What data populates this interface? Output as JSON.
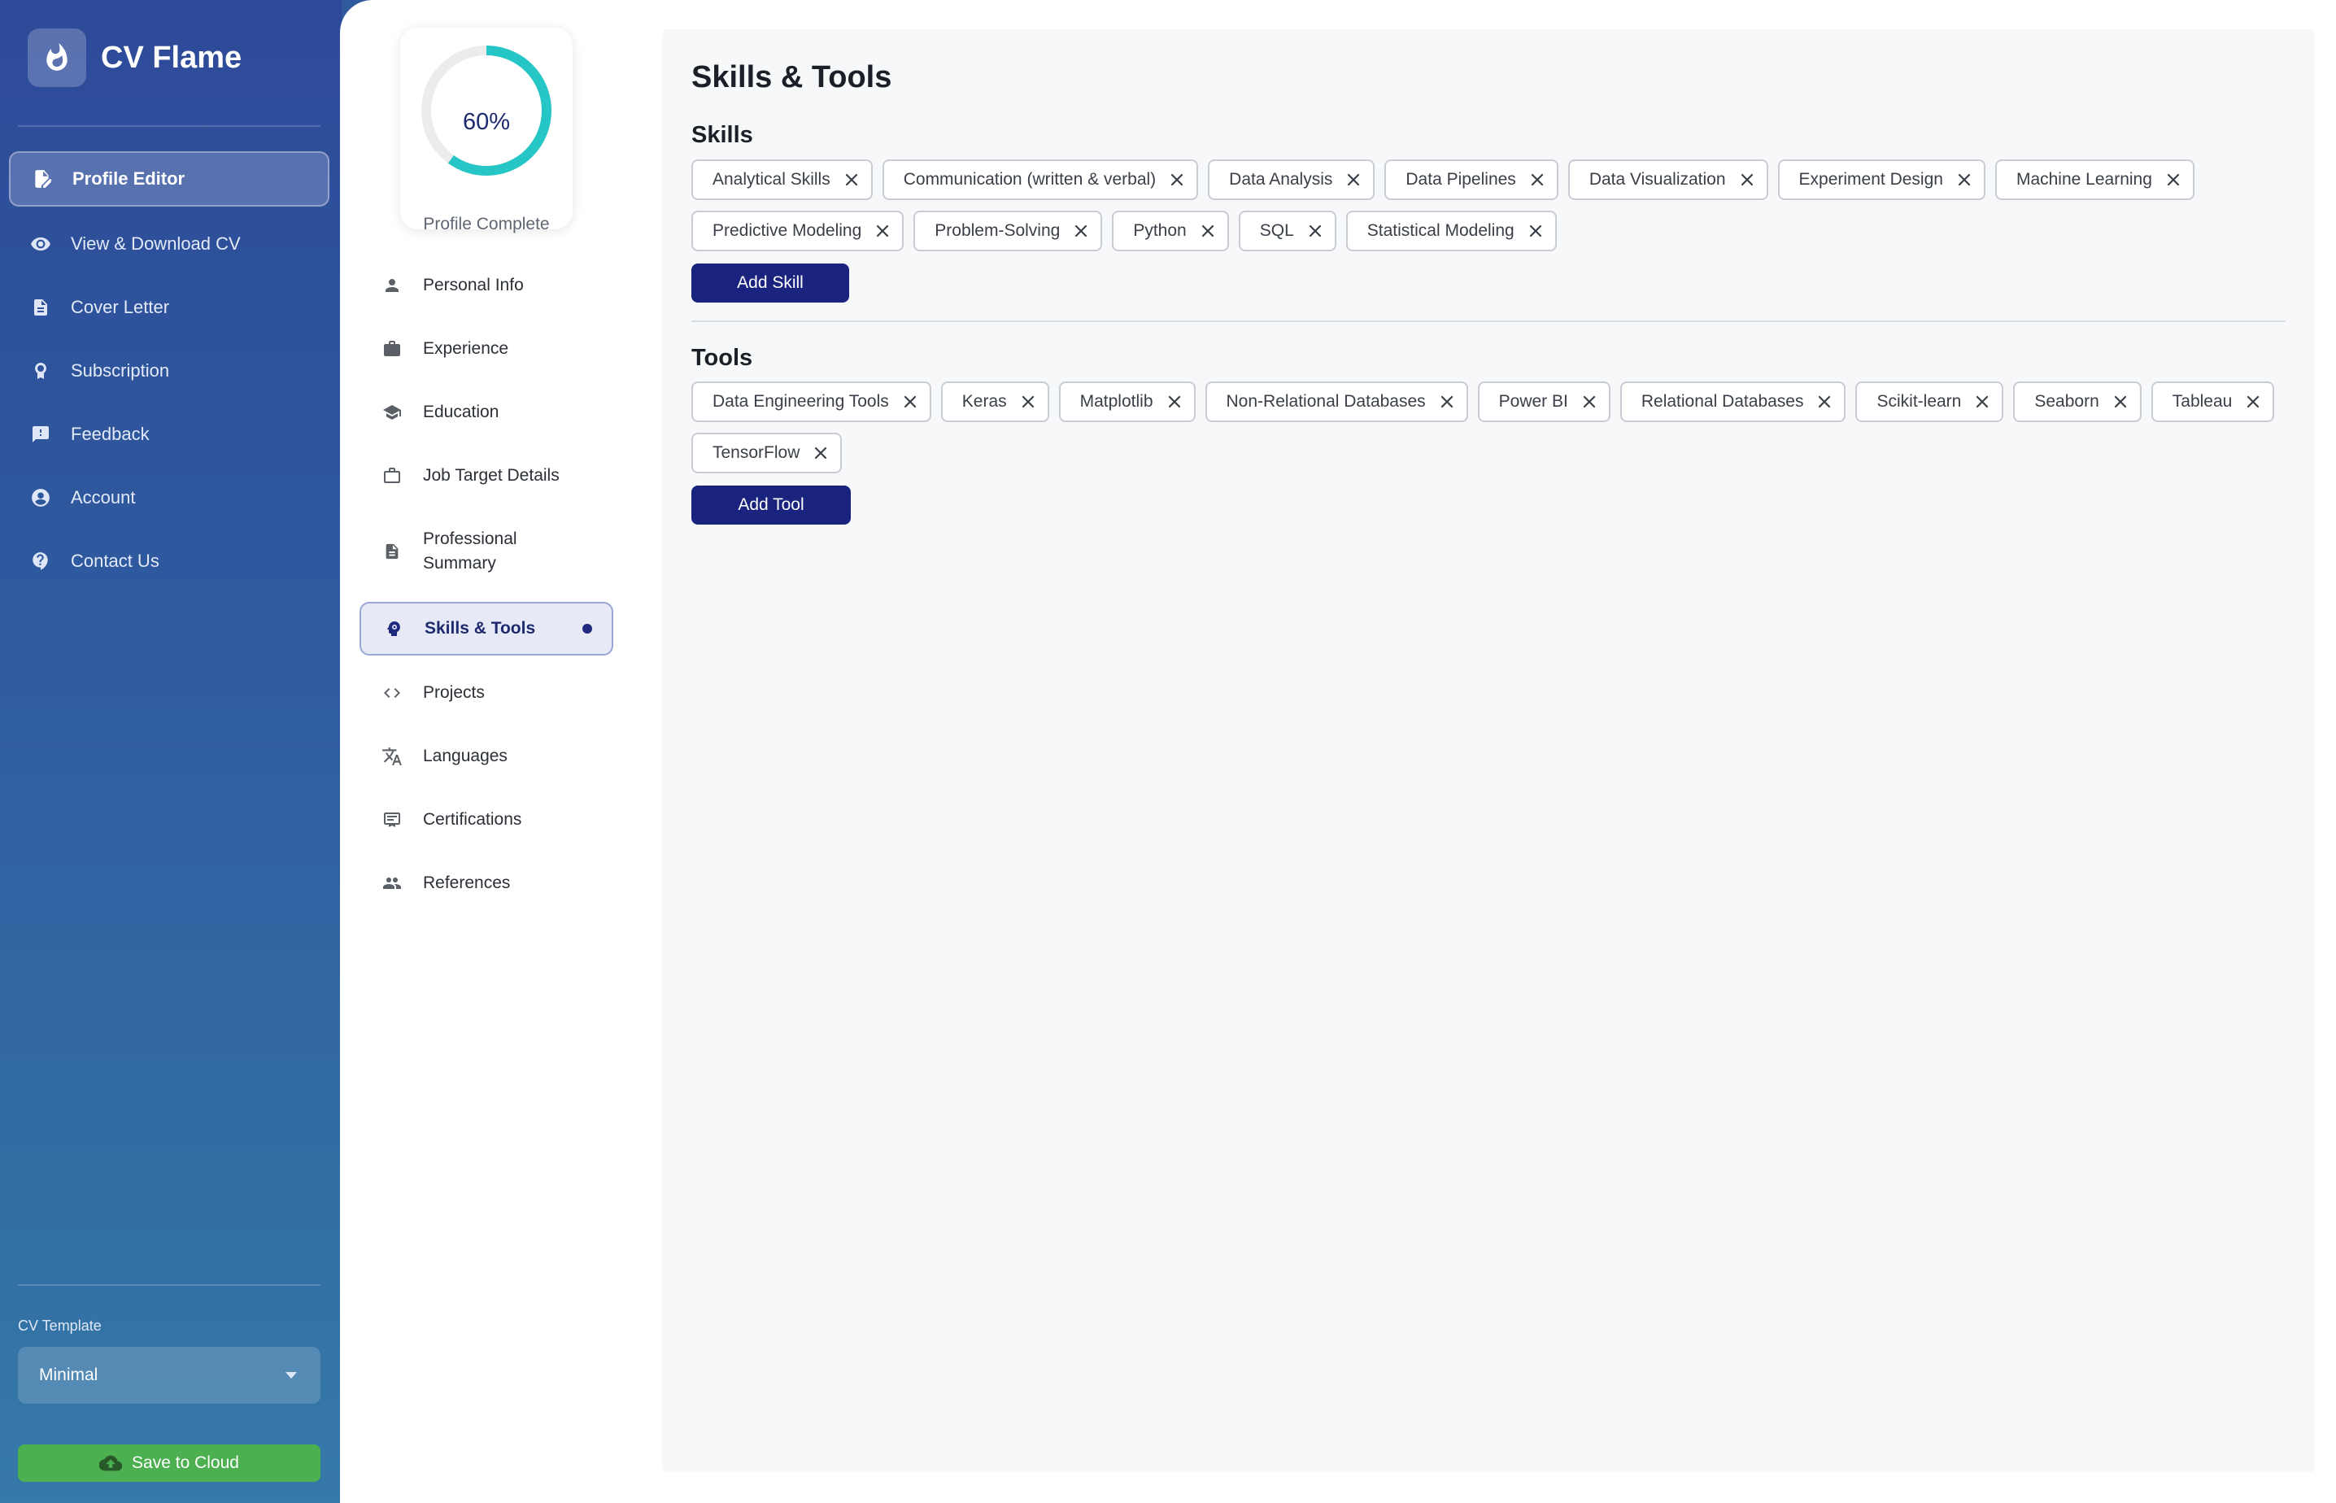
{
  "app": {
    "brand": "CV Flame",
    "nav": [
      {
        "label": "Profile Editor",
        "icon": "edit-document-icon"
      },
      {
        "label": "View & Download CV",
        "icon": "eye-icon"
      },
      {
        "label": "Cover Letter",
        "icon": "document-icon"
      },
      {
        "label": "Subscription",
        "icon": "badge-icon"
      },
      {
        "label": "Feedback",
        "icon": "feedback-icon"
      },
      {
        "label": "Account",
        "icon": "account-circle-icon"
      },
      {
        "label": "Contact Us",
        "icon": "help-icon"
      }
    ],
    "template_label": "CV Template",
    "template_value": "Minimal",
    "save_label": "Save to Cloud"
  },
  "progress": {
    "percent_label": "60%",
    "value": 0.6,
    "label": "Profile Complete"
  },
  "sections": [
    {
      "label": "Personal Info",
      "icon": "person-icon"
    },
    {
      "label": "Experience",
      "icon": "briefcase-icon"
    },
    {
      "label": "Education",
      "icon": "graduation-cap-icon"
    },
    {
      "label": "Job Target Details",
      "icon": "work-outline-icon"
    },
    {
      "label": "Professional Summary",
      "icon": "document-icon"
    },
    {
      "label": "Skills & Tools",
      "icon": "psychology-icon",
      "active": true
    },
    {
      "label": "Projects",
      "icon": "code-icon"
    },
    {
      "label": "Languages",
      "icon": "translate-icon"
    },
    {
      "label": "Certifications",
      "icon": "certificate-icon"
    },
    {
      "label": "References",
      "icon": "people-icon"
    }
  ],
  "content": {
    "title": "Skills & Tools",
    "skills_title": "Skills",
    "skills": [
      "Analytical Skills",
      "Communication (written & verbal)",
      "Data Analysis",
      "Data Pipelines",
      "Data Visualization",
      "Experiment Design",
      "Machine Learning",
      "Predictive Modeling",
      "Problem-Solving",
      "Python",
      "SQL",
      "Statistical Modeling"
    ],
    "add_skill_label": "Add Skill",
    "tools_title": "Tools",
    "tools": [
      "Data Engineering Tools",
      "Keras",
      "Matplotlib",
      "Non-Relational Databases",
      "Power BI",
      "Relational Databases",
      "Scikit-learn",
      "Seaborn",
      "Tableau",
      "TensorFlow"
    ],
    "add_tool_label": "Add Tool"
  },
  "colors": {
    "primary": "#1a237e",
    "accent_ring": "#26c6c6",
    "save_green": "#4caf50"
  }
}
